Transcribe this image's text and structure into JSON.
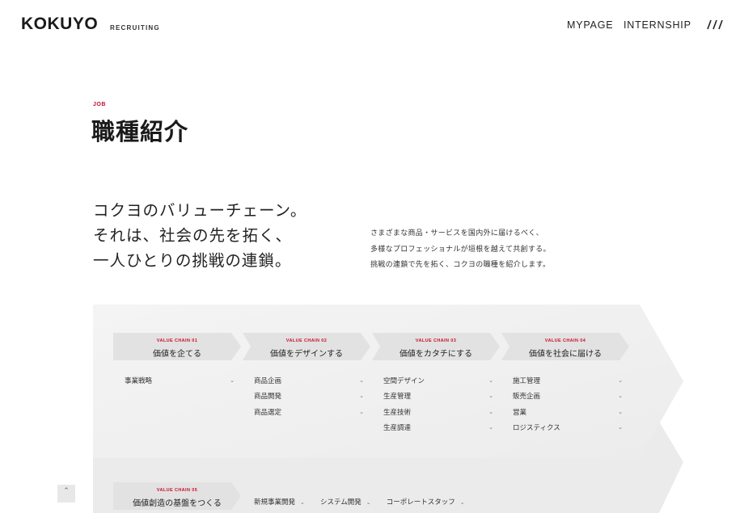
{
  "header": {
    "logo": "KOKUYO",
    "logo_sub": "RECRUITING",
    "nav": {
      "mypage": "MYPAGE",
      "internship": "INTERNSHIP"
    },
    "menu_icon": "slashes-menu-icon"
  },
  "title": {
    "label": "JOB",
    "text": "職種紹介"
  },
  "lead": {
    "lines": [
      "コクヨのバリューチェーン。",
      "それは、社会の先を拓く、",
      "一人ひとりの挑戦の連鎖。"
    ]
  },
  "description": {
    "lines": [
      "さまざまな商品・サービスを国内外に届けるべく、",
      "多様なプロフェッショナルが垣根を越えて共創する。",
      "挑戦の連鎖で先を拓く、コクヨの職種を紹介します。"
    ]
  },
  "chains": [
    {
      "label": "VALUE CHAIN 01",
      "title": "価値を企てる",
      "jobs": [
        "事業戦略"
      ]
    },
    {
      "label": "VALUE CHAIN 02",
      "title": "価値をデザインする",
      "jobs": [
        "商品企画",
        "商品開発",
        "商品選定"
      ]
    },
    {
      "label": "VALUE CHAIN 03",
      "title": "価値をカタチにする",
      "jobs": [
        "空間デザイン",
        "生産管理",
        "生産技術",
        "生産調達"
      ]
    },
    {
      "label": "VALUE CHAIN 04",
      "title": "価値を社会に届ける",
      "jobs": [
        "施工管理",
        "販売企画",
        "営業",
        "ロジスティクス"
      ]
    },
    {
      "label": "VALUE CHAIN 05",
      "title": "価値創造の基盤をつくる",
      "jobs": [
        "新規事業開発",
        "システム開発",
        "コーポレートスタッフ"
      ]
    }
  ],
  "icons": {
    "chevron": "chevron-down-icon",
    "scroll_top": "chevron-up-icon"
  },
  "colors": {
    "accent": "#c8102e",
    "panel": "#f2f2f2",
    "chain_bg": "#e4e4e4"
  }
}
